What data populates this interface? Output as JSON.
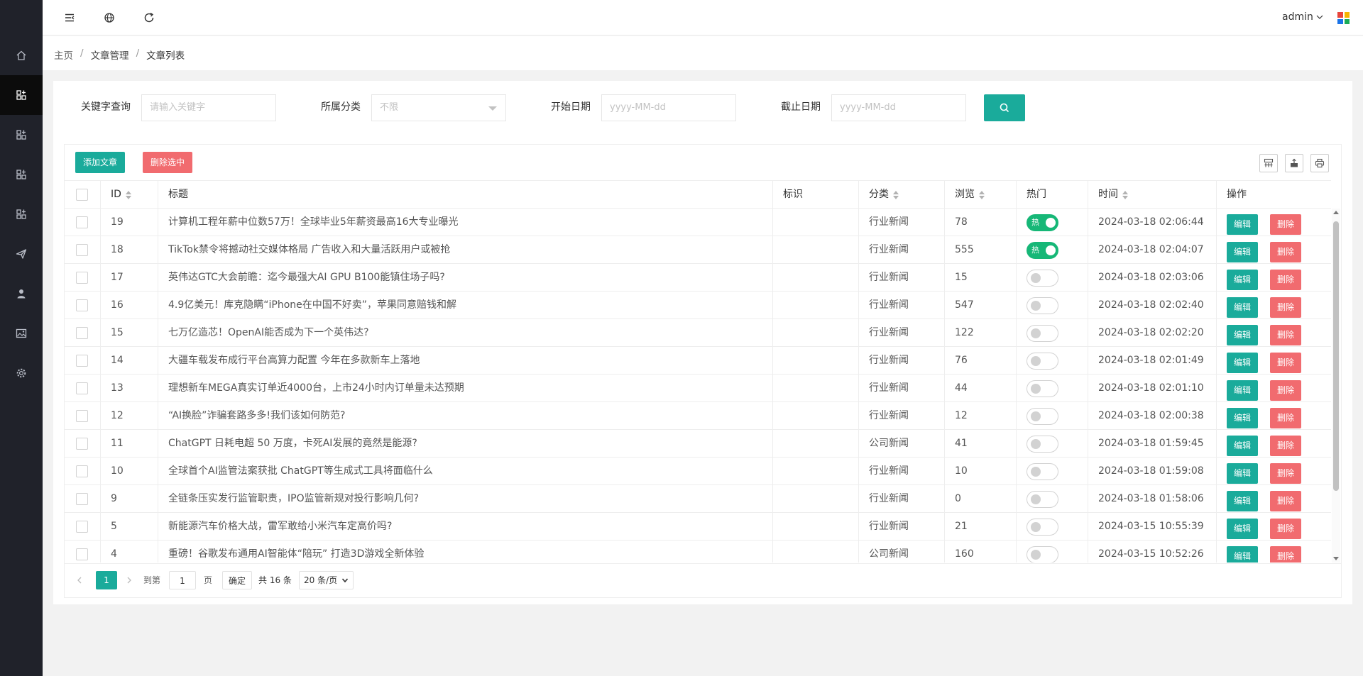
{
  "header": {
    "user": "admin"
  },
  "breadcrumb": [
    "主页",
    "文章管理",
    "文章列表"
  ],
  "search": {
    "keyword_label": "关键字查询",
    "keyword_placeholder": "请输入关键字",
    "category_label": "所属分类",
    "category_value": "不限",
    "start_label": "开始日期",
    "start_placeholder": "yyyy-MM-dd",
    "end_label": "截止日期",
    "end_placeholder": "yyyy-MM-dd"
  },
  "toolbar": {
    "add_label": "添加文章",
    "delete_selected_label": "删除选中"
  },
  "columns": [
    "ID",
    "标题",
    "标识",
    "分类",
    "浏览",
    "热门",
    "时间",
    "操作"
  ],
  "rows": [
    {
      "id": "19",
      "title": "计算机工程年薪中位数57万！全球毕业5年薪资最高16大专业曝光",
      "flag": "",
      "category": "行业新闻",
      "views": "78",
      "hot": true,
      "time": "2024-03-18 02:06:44"
    },
    {
      "id": "18",
      "title": "TikTok禁令将撼动社交媒体格局 广告收入和大量活跃用户或被抢",
      "flag": "",
      "category": "行业新闻",
      "views": "555",
      "hot": true,
      "time": "2024-03-18 02:04:07"
    },
    {
      "id": "17",
      "title": "英伟达GTC大会前瞻：迄今最强大AI GPU B100能镇住场子吗?",
      "flag": "",
      "category": "行业新闻",
      "views": "15",
      "hot": false,
      "time": "2024-03-18 02:03:06"
    },
    {
      "id": "16",
      "title": "4.9亿美元！库克隐瞒“iPhone在中国不好卖”，苹果同意赔钱和解",
      "flag": "",
      "category": "行业新闻",
      "views": "547",
      "hot": false,
      "time": "2024-03-18 02:02:40"
    },
    {
      "id": "15",
      "title": "七万亿造芯！OpenAI能否成为下一个英伟达?",
      "flag": "",
      "category": "行业新闻",
      "views": "122",
      "hot": false,
      "time": "2024-03-18 02:02:20"
    },
    {
      "id": "14",
      "title": "大疆车载发布成行平台高算力配置 今年在多款新车上落地",
      "flag": "",
      "category": "行业新闻",
      "views": "76",
      "hot": false,
      "time": "2024-03-18 02:01:49"
    },
    {
      "id": "13",
      "title": "理想新车MEGA真实订单近4000台，上市24小时内订单量未达预期",
      "flag": "",
      "category": "行业新闻",
      "views": "44",
      "hot": false,
      "time": "2024-03-18 02:01:10"
    },
    {
      "id": "12",
      "title": "“AI换脸”诈骗套路多多!我们该如何防范?",
      "flag": "",
      "category": "行业新闻",
      "views": "12",
      "hot": false,
      "time": "2024-03-18 02:00:38"
    },
    {
      "id": "11",
      "title": "ChatGPT 日耗电超 50 万度，卡死AI发展的竟然是能源?",
      "flag": "",
      "category": "公司新闻",
      "views": "41",
      "hot": false,
      "time": "2024-03-18 01:59:45"
    },
    {
      "id": "10",
      "title": "全球首个AI监管法案获批 ChatGPT等生成式工具将面临什么",
      "flag": "",
      "category": "行业新闻",
      "views": "10",
      "hot": false,
      "time": "2024-03-18 01:59:08"
    },
    {
      "id": "9",
      "title": "全链条压实发行监管职责，IPO监管新规对投行影响几何?",
      "flag": "",
      "category": "行业新闻",
      "views": "0",
      "hot": false,
      "time": "2024-03-18 01:58:06"
    },
    {
      "id": "5",
      "title": "新能源汽车价格大战，雷军敢给小米汽车定高价吗?",
      "flag": "",
      "category": "行业新闻",
      "views": "21",
      "hot": false,
      "time": "2024-03-15 10:55:39"
    },
    {
      "id": "4",
      "title": "重磅！谷歌发布通用AI智能体“陪玩” 打造3D游戏全新体验",
      "flag": "",
      "category": "公司新闻",
      "views": "160",
      "hot": false,
      "time": "2024-03-15 10:52:26"
    }
  ],
  "row_actions": {
    "edit": "编辑",
    "delete": "删除",
    "hot_text": "热"
  },
  "pager": {
    "current": "1",
    "goto_label": "到第",
    "goto_value": "1",
    "page_unit": "页",
    "confirm": "确定",
    "total": "共 16 条",
    "page_size": "20 条/页"
  },
  "colors": {
    "accent": "#1aab9b",
    "danger": "#f16b6f",
    "switch_on": "#16b777",
    "sidebar": "#20222a"
  }
}
